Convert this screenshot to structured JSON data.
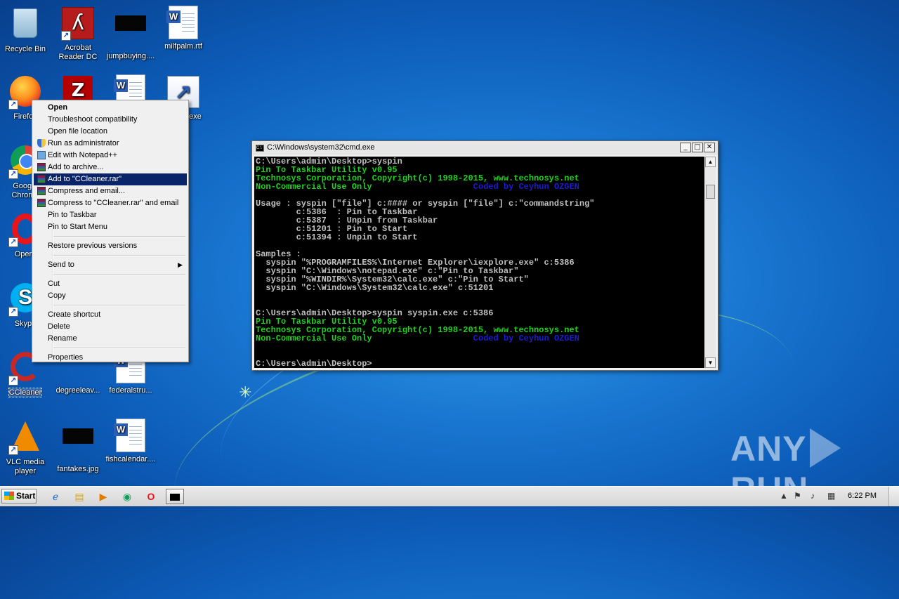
{
  "desktop": {
    "icons": [
      {
        "label": "Recycle Bin"
      },
      {
        "label": "Acrobat Reader DC"
      },
      {
        "label": "jumpbuying...."
      },
      {
        "label": "milfpalm.rtf"
      },
      {
        "label": "Firefox"
      },
      {
        "label": ""
      },
      {
        "label": ""
      },
      {
        "label": "exe"
      },
      {
        "label": "Google Chrome"
      },
      {
        "label": "Opera"
      },
      {
        "label": "Skype"
      },
      {
        "label": "CCleaner"
      },
      {
        "label": "degreeleav..."
      },
      {
        "label": "federalstru..."
      },
      {
        "label": "VLC media player"
      },
      {
        "label": "fantakes.jpg"
      },
      {
        "label": "fishcalendar...."
      }
    ]
  },
  "context_menu": {
    "items": [
      {
        "label": "Open"
      },
      {
        "label": "Troubleshoot compatibility"
      },
      {
        "label": "Open file location"
      },
      {
        "label": "Run as administrator"
      },
      {
        "label": "Edit with Notepad++"
      },
      {
        "label": "Add to archive..."
      },
      {
        "label": "Add to \"CCleaner.rar\""
      },
      {
        "label": "Compress and email..."
      },
      {
        "label": "Compress to \"CCleaner.rar\" and email"
      },
      {
        "label": "Pin to Taskbar"
      },
      {
        "label": "Pin to Start Menu"
      },
      {
        "label": "Restore previous versions"
      },
      {
        "label": "Send to"
      },
      {
        "label": "Cut"
      },
      {
        "label": "Copy"
      },
      {
        "label": "Create shortcut"
      },
      {
        "label": "Delete"
      },
      {
        "label": "Rename"
      },
      {
        "label": "Properties"
      }
    ],
    "highlighted": "Add to \"CCleaner.rar\""
  },
  "cmd_window": {
    "title": "C:\\Windows\\system32\\cmd.exe",
    "lines": [
      {
        "t": "C:\\Users\\admin\\Desktop>syspin",
        "c": "w"
      },
      {
        "t": "Pin To Taskbar Utility v0.95",
        "c": "g"
      },
      {
        "t": "Technosys Corporation, Copyright(c) 1998-2015, www.technosys.net",
        "c": "g"
      },
      {
        "t": "Non-Commercial Use Only",
        "c": "g",
        "right": "Coded by Ceyhun OZGEN"
      },
      {
        "t": "",
        "c": "w"
      },
      {
        "t": "Usage : syspin [\"file\"] c:#### or syspin [\"file\"] c:\"commandstring\"",
        "c": "w"
      },
      {
        "t": "        c:5386  : Pin to Taskbar",
        "c": "w"
      },
      {
        "t": "        c:5387  : Unpin from Taskbar",
        "c": "w"
      },
      {
        "t": "        c:51201 : Pin to Start",
        "c": "w"
      },
      {
        "t": "        c:51394 : Unpin to Start",
        "c": "w"
      },
      {
        "t": "",
        "c": "w"
      },
      {
        "t": "Samples :",
        "c": "w"
      },
      {
        "t": "  syspin \"%PROGRAMFILES%\\Internet Explorer\\iexplore.exe\" c:5386",
        "c": "w"
      },
      {
        "t": "  syspin \"C:\\Windows\\notepad.exe\" c:\"Pin to Taskbar\"",
        "c": "w"
      },
      {
        "t": "  syspin \"%WINDIR%\\System32\\calc.exe\" c:\"Pin to Start\"",
        "c": "w"
      },
      {
        "t": "  syspin \"C:\\Windows\\System32\\calc.exe\" c:51201",
        "c": "w"
      },
      {
        "t": "",
        "c": "w"
      },
      {
        "t": "",
        "c": "w"
      },
      {
        "t": "C:\\Users\\admin\\Desktop>syspin syspin.exe c:5386",
        "c": "w"
      },
      {
        "t": "Pin To Taskbar Utility v0.95",
        "c": "g"
      },
      {
        "t": "Technosys Corporation, Copyright(c) 1998-2015, www.technosys.net",
        "c": "g"
      },
      {
        "t": "Non-Commercial Use Only",
        "c": "g",
        "right": "Coded by Ceyhun OZGEN"
      },
      {
        "t": "",
        "c": "w"
      },
      {
        "t": "",
        "c": "w"
      },
      {
        "t": "C:\\Users\\admin\\Desktop>",
        "c": "w"
      }
    ]
  },
  "watermark": {
    "left": "ANY",
    "right": "RUN"
  },
  "taskbar": {
    "start_label": "Start",
    "clock": "6:22 PM"
  },
  "colors": {
    "desktop_blue": "#1a78d2",
    "menu_highlight": "#0a246a",
    "console_green": "#1fd11f",
    "console_blue": "#1b1bd6"
  }
}
